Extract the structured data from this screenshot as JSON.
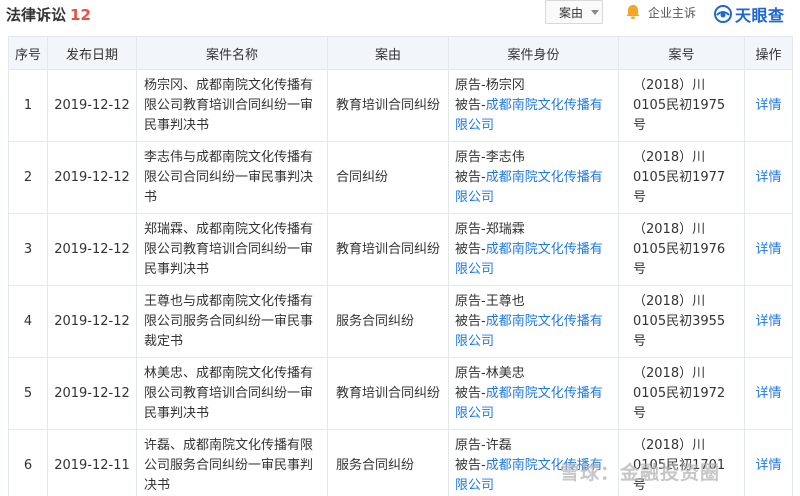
{
  "header": {
    "title": "法律诉讼",
    "count": "12",
    "filter_label": "案由",
    "owner_label": "企业主诉",
    "brand": "天眼查"
  },
  "table": {
    "columns": [
      "序号",
      "发布日期",
      "案件名称",
      "案由",
      "案件身份",
      "案号",
      "操作"
    ],
    "rows": [
      {
        "index": "1",
        "date": "2019-12-12",
        "name": "杨宗冈、成都南院文化传播有限公司教育培训合同纠纷一审民事判决书",
        "cause": "教育培训合同纠纷",
        "plaintiff_prefix": "原告-",
        "plaintiff": "杨宗冈",
        "defendant_prefix": "被告-",
        "defendant": "成都南院文化传播有限公司",
        "case_no": "（2018）川0105民初1975号",
        "action": "详情"
      },
      {
        "index": "2",
        "date": "2019-12-12",
        "name": "李志伟与成都南院文化传播有限公司合同纠纷一审民事判决书",
        "cause": "合同纠纷",
        "plaintiff_prefix": "原告-",
        "plaintiff": "李志伟",
        "defendant_prefix": "被告-",
        "defendant": "成都南院文化传播有限公司",
        "case_no": "（2018）川0105民初1977号",
        "action": "详情"
      },
      {
        "index": "3",
        "date": "2019-12-12",
        "name": "郑瑞霖、成都南院文化传播有限公司教育培训合同纠纷一审民事判决书",
        "cause": "教育培训合同纠纷",
        "plaintiff_prefix": "原告-",
        "plaintiff": "郑瑞霖",
        "defendant_prefix": "被告-",
        "defendant": "成都南院文化传播有限公司",
        "case_no": "（2018）川0105民初1976号",
        "action": "详情"
      },
      {
        "index": "4",
        "date": "2019-12-12",
        "name": "王尊也与成都南院文化传播有限公司服务合同纠纷一审民事裁定书",
        "cause": "服务合同纠纷",
        "plaintiff_prefix": "原告-",
        "plaintiff": "王尊也",
        "defendant_prefix": "被告-",
        "defendant": "成都南院文化传播有限公司",
        "case_no": "（2018）川0105民初3955号",
        "action": "详情"
      },
      {
        "index": "5",
        "date": "2019-12-12",
        "name": "林美忠、成都南院文化传播有限公司教育培训合同纠纷一审民事判决书",
        "cause": "教育培训合同纠纷",
        "plaintiff_prefix": "原告-",
        "plaintiff": "林美忠",
        "defendant_prefix": "被告-",
        "defendant": "成都南院文化传播有限公司",
        "case_no": "（2018）川0105民初1972号",
        "action": "详情"
      },
      {
        "index": "6",
        "date": "2019-12-11",
        "name": "许磊、成都南院文化传播有限公司服务合同纠纷一审民事判决书",
        "cause": "服务合同纠纷",
        "plaintiff_prefix": "原告-",
        "plaintiff": "许磊",
        "defendant_prefix": "被告-",
        "defendant": "成都南院文化传播有限公司",
        "case_no": "（2018）川0105民初1701号",
        "action": "详情"
      }
    ]
  },
  "watermark": "雪球：金融投资圈",
  "colors": {
    "accent_red": "#e94f3c",
    "link_blue": "#1e7ae8",
    "brand_blue": "#1c66d6",
    "header_bg": "#f2f6fb",
    "border": "#e3e7ee"
  }
}
